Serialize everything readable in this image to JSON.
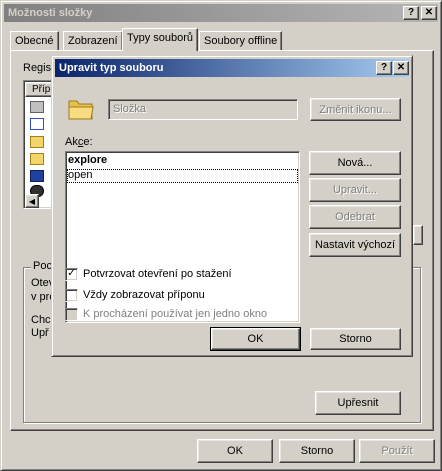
{
  "main_window": {
    "title": "Možnosti složky",
    "help_btn": "?",
    "close_btn": "✕",
    "tabs": [
      {
        "label": "Obecné"
      },
      {
        "label": "Zobrazení"
      },
      {
        "label": "Typy souborů"
      },
      {
        "label": "Soubory offline"
      }
    ],
    "registered_label_partial": "Regis",
    "list_header_partial": "Příp",
    "details_group_title_partial": "Poc",
    "details_text_line1_partial": "Otev",
    "details_text_line2_partial": "v pro",
    "details_text_line3_partial": "Chc",
    "details_text_line4_partial": "Upř",
    "advanced_button": "Upřesnit",
    "ok_button": "OK",
    "cancel_button": "Storno",
    "apply_button": "Použít"
  },
  "dialog": {
    "title": "Upravit typ souboru",
    "help_btn": "?",
    "close_btn": "✕",
    "type_name_value": "Složka",
    "change_icon_button": "Změnit ikonu...",
    "actions_label": "Akce:",
    "actions": [
      {
        "label": "explore",
        "bold": true
      },
      {
        "label": "open",
        "bold": false
      }
    ],
    "new_button": "Nová...",
    "edit_button": "Upravit...",
    "remove_button": "Odebrat",
    "set_default_button": "Nastavit výchozí",
    "confirm_open_label": "Potvrzovat otevření po stažení",
    "confirm_open_checked": true,
    "always_show_ext_label": "Vždy zobrazovat příponu",
    "always_show_ext_checked": false,
    "browse_same_window_label": "K procházení používat jen jedno okno",
    "browse_same_window_checked": false,
    "ok_button": "OK",
    "cancel_button": "Storno"
  },
  "colors": {
    "face": "#d4d0c8",
    "active_title_start": "#0a246a",
    "active_title_end": "#a6caf0",
    "inactive_title_start": "#808080",
    "folder_yellow": "#f4d56a"
  }
}
